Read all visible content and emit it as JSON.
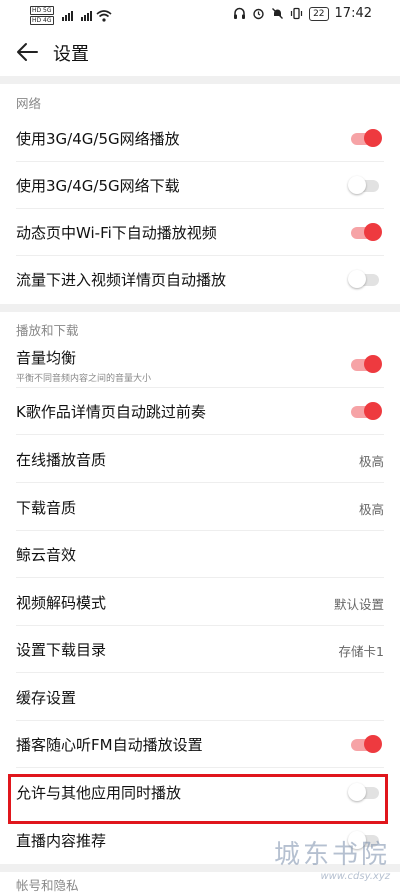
{
  "status_bar": {
    "sim1_label": "HD 5G",
    "sim2_label": "HD 4G",
    "battery": "22",
    "time": "17:42"
  },
  "header": {
    "title": "设置"
  },
  "sections": {
    "network": "网络",
    "playback": "播放和下载",
    "account": "帐号和隐私"
  },
  "rows": [
    {
      "label": "使用3G/4G/5G网络播放",
      "toggle": true
    },
    {
      "label": "使用3G/4G/5G网络下载",
      "toggle": false
    },
    {
      "label": "动态页中Wi-Fi下自动播放视频",
      "toggle": true
    },
    {
      "label": "流量下进入视频详情页自动播放",
      "toggle": false
    },
    {
      "label": "音量均衡",
      "sub": "平衡不同音频内容之间的音量大小",
      "toggle": true
    },
    {
      "label": "K歌作品详情页自动跳过前奏",
      "toggle": true
    },
    {
      "label": "在线播放音质",
      "value": "极高"
    },
    {
      "label": "下载音质",
      "value": "极高"
    },
    {
      "label": "鲸云音效"
    },
    {
      "label": "视频解码模式",
      "value": "默认设置"
    },
    {
      "label": "设置下载目录",
      "value": "存储卡1"
    },
    {
      "label": "缓存设置"
    },
    {
      "label": "播客随心听FM自动播放设置",
      "toggle": true
    },
    {
      "label": "允许与其他应用同时播放",
      "toggle": false
    },
    {
      "label": "直播内容推荐",
      "toggle": false
    }
  ],
  "watermark": {
    "title": "城东书院",
    "url": "www.cdsy.xyz"
  },
  "colors": {
    "accent": "#ee3a3f",
    "highlight_box": "#e0161c"
  }
}
